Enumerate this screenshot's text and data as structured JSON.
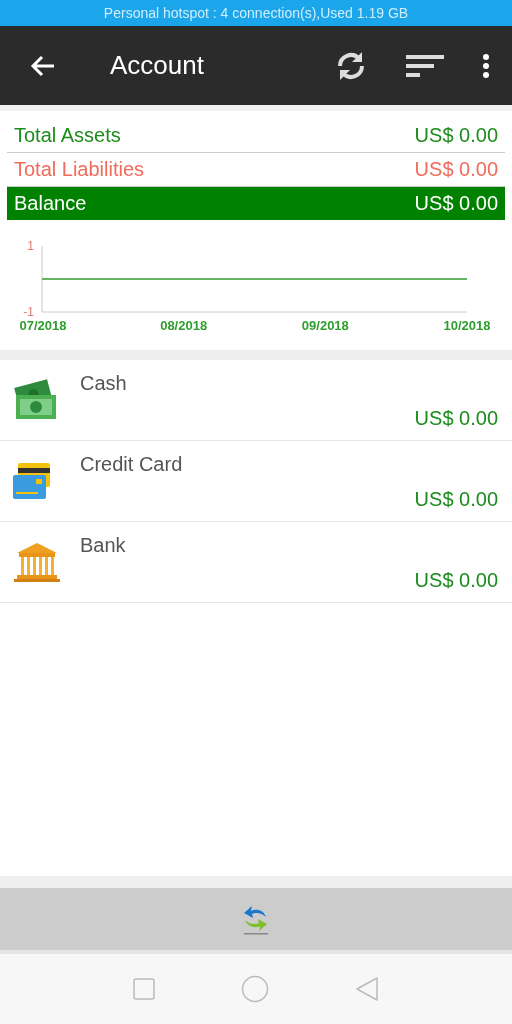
{
  "status_bar": {
    "text": "Personal hotspot : 4 connection(s),Used  1.19 GB"
  },
  "app_bar": {
    "title": "Account"
  },
  "summary": [
    {
      "kind": "assets",
      "label": "Total Assets",
      "amount": "US$ 0.00"
    },
    {
      "kind": "liabilities",
      "label": "Total Liabilities",
      "amount": "US$ 0.00"
    },
    {
      "kind": "balance",
      "label": "Balance",
      "amount": "US$ 0.00"
    }
  ],
  "chart_data": {
    "type": "line",
    "categories": [
      "07/2018",
      "08/2018",
      "09/2018",
      "10/2018"
    ],
    "series": [
      {
        "color": "#2e9e2e",
        "values": [
          0,
          0,
          0,
          0
        ]
      }
    ],
    "ylim": [
      -1,
      1
    ],
    "yticks": [
      1,
      -1
    ]
  },
  "accounts": [
    {
      "kind": "cash",
      "name": "Cash",
      "amount": "US$ 0.00"
    },
    {
      "kind": "card",
      "name": "Credit Card",
      "amount": "US$ 0.00"
    },
    {
      "kind": "bank",
      "name": "Bank",
      "amount": "US$ 0.00"
    }
  ]
}
